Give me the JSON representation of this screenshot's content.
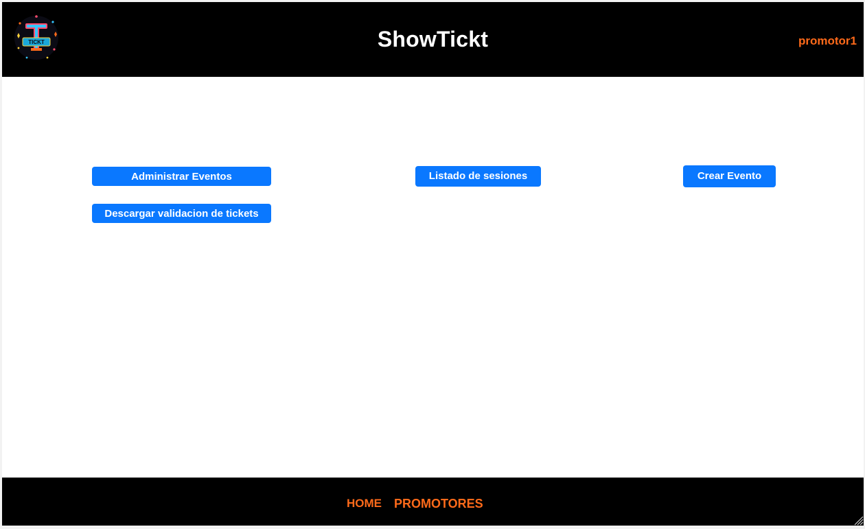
{
  "header": {
    "title": "ShowTickt",
    "user": "promotor1",
    "logo_icon": "showtickt-logo-icon"
  },
  "actions": {
    "manage_events": "Administrar Eventos",
    "session_list": "Listado de sesiones",
    "create_event": "Crear Evento",
    "download_ticket_validation": "Descargar validacion de tickets"
  },
  "footer": {
    "home": "HOME",
    "promoters": "PROMOTORES"
  },
  "colors": {
    "header_bg": "#000000",
    "accent_orange": "#ff6a1a",
    "button_blue": "#0a78ff"
  }
}
